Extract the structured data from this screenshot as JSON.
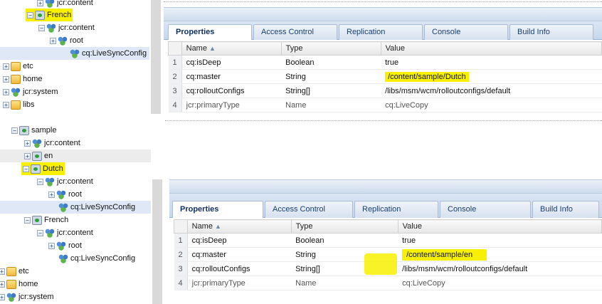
{
  "top": {
    "tree": {
      "items": [
        {
          "label": "jcr:content",
          "icon": "node-icon"
        },
        {
          "label": "French",
          "icon": "page-icon",
          "highlighted": true
        },
        {
          "label": "jcr:content",
          "icon": "node-icon"
        },
        {
          "label": "root",
          "icon": "node-icon"
        },
        {
          "label": "cq:LiveSyncConfig",
          "icon": "node-icon",
          "selected": true
        },
        {
          "label": "etc",
          "icon": "folder-icon"
        },
        {
          "label": "home",
          "icon": "folder-icon"
        },
        {
          "label": "jcr:system",
          "icon": "node-icon"
        },
        {
          "label": "libs",
          "icon": "folder-icon"
        }
      ]
    },
    "tabs": [
      "Properties",
      "Access Control",
      "Replication",
      "Console",
      "Build Info"
    ],
    "columns": [
      "Name",
      "Type",
      "Value"
    ],
    "rows": [
      {
        "num": "1",
        "name": "cq:isDeep",
        "type": "Boolean",
        "value": "true"
      },
      {
        "num": "2",
        "name": "cq:master",
        "type": "String",
        "value": "/content/sample/Dutch"
      },
      {
        "num": "3",
        "name": "cq:rolloutConfigs",
        "type": "String[]",
        "value": "/libs/msm/wcm/rolloutconfigs/default"
      },
      {
        "num": "4",
        "name": "jcr:primaryType",
        "type": "Name",
        "value": "cq:LiveCopy"
      }
    ]
  },
  "bottom": {
    "tree": {
      "items": [
        {
          "label": "sample",
          "icon": "page-icon"
        },
        {
          "label": "jcr:content",
          "icon": "node-icon"
        },
        {
          "label": "en",
          "icon": "page-icon"
        },
        {
          "label": "Dutch",
          "icon": "page-icon",
          "highlighted": true
        },
        {
          "label": "jcr:content",
          "icon": "node-icon"
        },
        {
          "label": "root",
          "icon": "node-icon"
        },
        {
          "label": "cq:LiveSyncConfig",
          "icon": "node-icon",
          "selected": true
        },
        {
          "label": "French",
          "icon": "page-icon"
        },
        {
          "label": "jcr:content",
          "icon": "node-icon"
        },
        {
          "label": "root",
          "icon": "node-icon"
        },
        {
          "label": "cq:LiveSyncConfig",
          "icon": "node-icon"
        },
        {
          "label": "etc",
          "icon": "folder-icon"
        },
        {
          "label": "home",
          "icon": "folder-icon"
        },
        {
          "label": "jcr:system",
          "icon": "node-icon"
        }
      ]
    },
    "tabs": [
      "Properties",
      "Access Control",
      "Replication",
      "Console",
      "Build Info"
    ],
    "columns": [
      "Name",
      "Type",
      "Value"
    ],
    "rows": [
      {
        "num": "1",
        "name": "cq:isDeep",
        "type": "Boolean",
        "value": "true"
      },
      {
        "num": "2",
        "name": "cq:master",
        "type": "String",
        "value": "/content/sample/en"
      },
      {
        "num": "3",
        "name": "cq:rolloutConfigs",
        "type": "String[]",
        "value": "/libs/msm/wcm/rolloutconfigs/default"
      },
      {
        "num": "4",
        "name": "jcr:primaryType",
        "type": "Name",
        "value": "cq:LiveCopy"
      }
    ]
  },
  "colors": {
    "highlight": "#f7f000",
    "selected_row": "#dfe8f6",
    "tab_blue": "#1c3f6e"
  }
}
